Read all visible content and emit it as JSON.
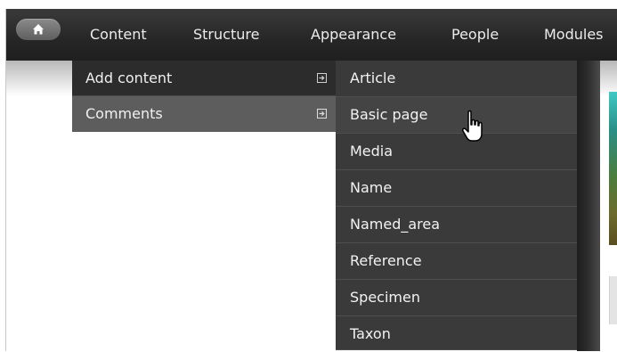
{
  "toolbar": {
    "home_icon": "home-icon",
    "nav_items": [
      "Content",
      "Structure",
      "Appearance",
      "People",
      "Modules"
    ]
  },
  "submenu": {
    "items": [
      {
        "label": "Add content",
        "icon": "arrow-right-box-icon"
      },
      {
        "label": "Comments",
        "icon": "arrow-right-box-icon"
      }
    ]
  },
  "flyout": {
    "items": [
      "Article",
      "Basic page",
      "Media",
      "Name",
      "Named_area",
      "Reference",
      "Specimen",
      "Taxon"
    ]
  },
  "cursor": {
    "icon": "hand-pointer-icon"
  },
  "colors": {
    "toolbar_bg": "#262626",
    "submenu_bg": "#2c2c2c",
    "submenu_active_bg": "#5d5d5d",
    "flyout_bg": "#3a3a3a",
    "text": "#f0f0f0"
  }
}
